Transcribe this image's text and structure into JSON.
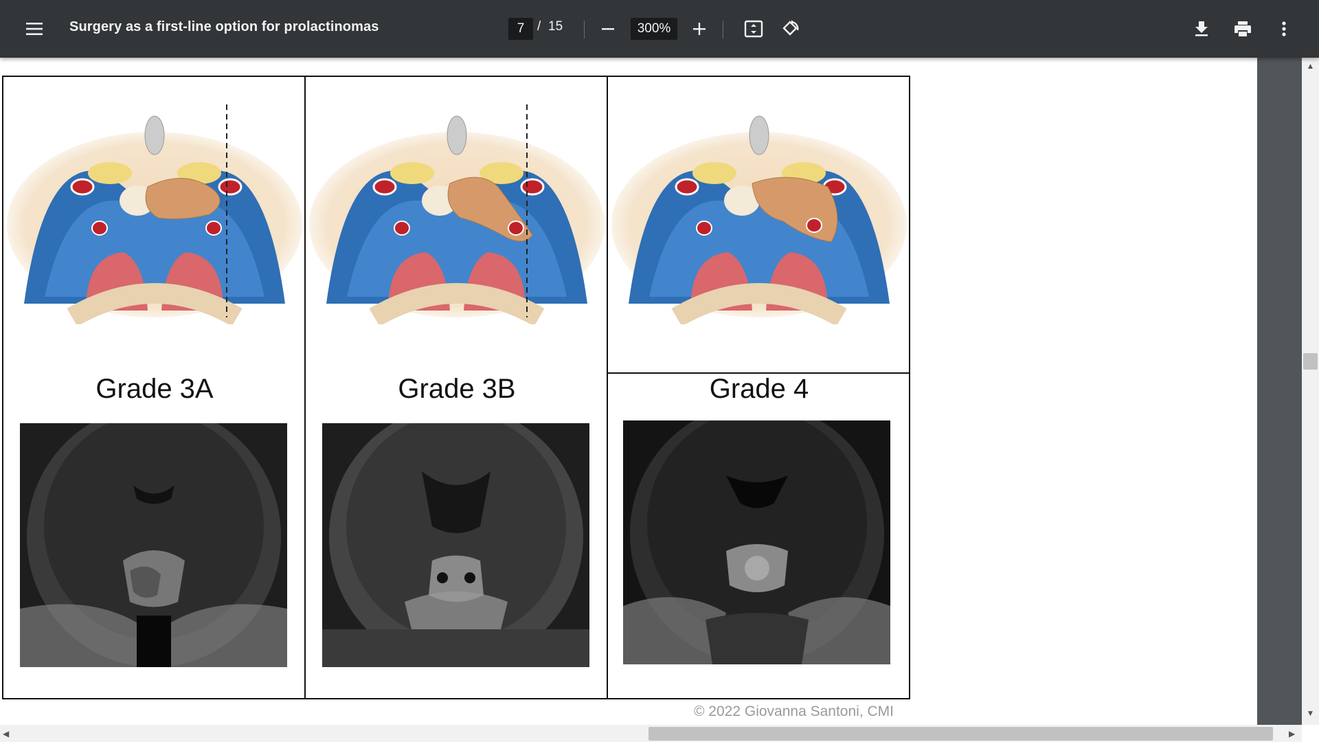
{
  "toolbar": {
    "title": "Surgery as a first-line option for prolactinomas",
    "current_page": "7",
    "page_separator": "/",
    "total_pages": "15",
    "zoom": "300%",
    "icons": [
      "menu-icon",
      "zoom-out-icon",
      "zoom-in-icon",
      "fit-page-icon",
      "rotate-icon",
      "download-icon",
      "print-icon",
      "more-vert-icon"
    ]
  },
  "figure": {
    "panels": [
      {
        "caption": "Grade 3A",
        "dashed_line": true
      },
      {
        "caption": "Grade 3B",
        "dashed_line": true
      },
      {
        "caption": "Grade 4",
        "dashed_line": false
      }
    ],
    "copyright": "© 2022 Giovanna Santoni, CMI"
  },
  "scrollbars": {
    "vertical_arrow_up": "▲",
    "vertical_arrow_down": "▼",
    "horizontal_arrow_left": "◀",
    "horizontal_arrow_right": "▶"
  }
}
